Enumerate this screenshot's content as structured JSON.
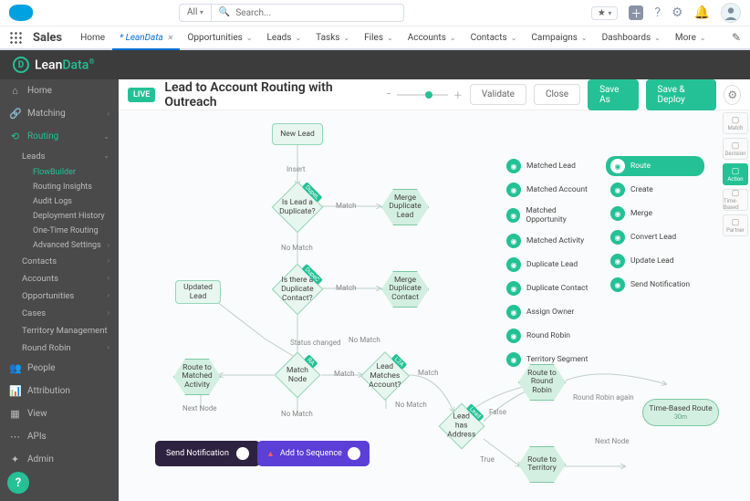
{
  "top": {
    "search_scope": "All",
    "search_placeholder": "Search...",
    "icons": [
      "star",
      "plus",
      "help",
      "gear",
      "bell",
      "avatar"
    ]
  },
  "nav": {
    "app": "Sales",
    "items": [
      {
        "label": "Home"
      },
      {
        "label": "LeanData",
        "active": true,
        "closable": true
      },
      {
        "label": "Opportunities",
        "menu": true
      },
      {
        "label": "Leads",
        "menu": true
      },
      {
        "label": "Tasks",
        "menu": true
      },
      {
        "label": "Files",
        "menu": true
      },
      {
        "label": "Accounts",
        "menu": true
      },
      {
        "label": "Contacts",
        "menu": true
      },
      {
        "label": "Campaigns",
        "menu": true
      },
      {
        "label": "Dashboards",
        "menu": true
      },
      {
        "label": "More",
        "menu": true
      }
    ]
  },
  "leandata": {
    "brand": "LeanData"
  },
  "sidebar": {
    "items": [
      {
        "icon": "home",
        "label": "Home"
      },
      {
        "icon": "match",
        "label": "Matching",
        "expand": true
      },
      {
        "icon": "route",
        "label": "Routing",
        "expand": true,
        "selected": true
      },
      {
        "icon": "people",
        "label": "People"
      },
      {
        "icon": "attrib",
        "label": "Attribution"
      },
      {
        "icon": "view",
        "label": "View"
      },
      {
        "icon": "api",
        "label": "APIs"
      },
      {
        "icon": "admin",
        "label": "Admin"
      }
    ],
    "routing_children": [
      {
        "label": "Leads",
        "expand": true,
        "children": [
          {
            "label": "FlowBuilder",
            "selected": true
          },
          {
            "label": "Routing Insights"
          },
          {
            "label": "Audit Logs"
          },
          {
            "label": "Deployment History"
          },
          {
            "label": "One-Time Routing"
          },
          {
            "label": "Advanced Settings",
            "expand": true
          }
        ]
      },
      {
        "label": "Contacts",
        "expand": true
      },
      {
        "label": "Accounts",
        "expand": true
      },
      {
        "label": "Opportunities",
        "expand": true
      },
      {
        "label": "Cases",
        "expand": true
      },
      {
        "label": "Territory Management"
      },
      {
        "label": "Round Robin",
        "expand": true
      }
    ]
  },
  "toolbar": {
    "live": "LIVE",
    "title": "Lead to Account Routing with Outreach",
    "validate": "Validate",
    "close": "Close",
    "save_as": "Save As",
    "save_deploy": "Save & Deploy"
  },
  "palette": {
    "col1": [
      {
        "icon": "lead",
        "label": "Matched Lead"
      },
      {
        "icon": "acct",
        "label": "Matched Account"
      },
      {
        "icon": "opp",
        "label": "Matched Opportunity"
      },
      {
        "icon": "act",
        "label": "Matched Activity"
      },
      {
        "icon": "dup",
        "label": "Duplicate Lead"
      },
      {
        "icon": "dupc",
        "label": "Duplicate Contact"
      },
      {
        "icon": "own",
        "label": "Assign Owner"
      },
      {
        "icon": "rr",
        "label": "Round Robin"
      },
      {
        "icon": "terr",
        "label": "Territory Segment"
      }
    ],
    "col2": [
      {
        "icon": "route",
        "label": "Route",
        "selected": true
      },
      {
        "icon": "create",
        "label": "Create"
      },
      {
        "icon": "merge",
        "label": "Merge"
      },
      {
        "icon": "conv",
        "label": "Convert Lead"
      },
      {
        "icon": "upd",
        "label": "Update Lead"
      },
      {
        "icon": "notif",
        "label": "Send Notification"
      }
    ]
  },
  "rail": [
    {
      "label": "Match"
    },
    {
      "label": "Decision"
    },
    {
      "label": "Action",
      "selected": true
    },
    {
      "label": "Time-Based"
    },
    {
      "label": "Partner"
    }
  ],
  "flow": {
    "new_lead": "New Lead",
    "insert": "Insert",
    "dupeL_tag": "DupeL",
    "dupeL": "Is Lead a Duplicate?",
    "match": "Match",
    "no_match": "No Match",
    "merge_dup_lead": "Merge Duplicate Lead",
    "dupeC_tag": "DupeC",
    "dupeC": "Is there a Duplicate Contact?",
    "merge_dup_contact": "Merge Duplicate Contact",
    "updated_lead": "Updated Lead",
    "status_changed": "Status changed",
    "ra_tag": "RA",
    "match_node": "Match Node",
    "l2a_tag": "L2A",
    "l2a": "Lead Matches Account?",
    "route_matched_activity": "Route to Matched Activity",
    "next_node": "Next Node",
    "send_notification": "Send Notification",
    "add_to_sequence": "Add to Sequence",
    "lead_tag": "Lead",
    "lead_has_address": "Lead has Address",
    "true": "True",
    "false": "False",
    "route_rr": "Route to Round Robin",
    "rr_again": "Round Robin again",
    "time_route": "Time-Based Route",
    "time_route_sub": "30m",
    "route_territory": "Route to Territory"
  }
}
